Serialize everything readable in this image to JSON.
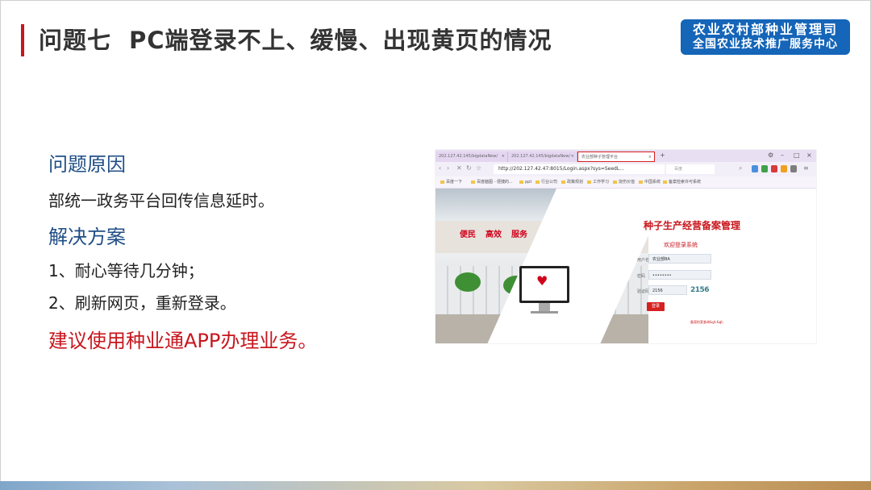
{
  "slide": {
    "title_num": "问题七",
    "title_text": "PC端登录不上、缓慢、出现黄页的情况",
    "org_line1": "农业农村部种业管理司",
    "org_line2": "全国农业技术推广服务中心"
  },
  "content": {
    "cause_heading": "问题原因",
    "cause_text": "部统一政务平台回传信息延时。",
    "solution_heading": "解决方案",
    "solution_items": [
      "1、耐心等待几分钟；",
      "2、刷新网页，重新登录。"
    ],
    "recommendation": "建议使用种业通APP办理业务。"
  },
  "screenshot": {
    "tabs": [
      {
        "label": "202.127.42.145/bigdataNew/"
      },
      {
        "label": "202.127.42.145/bigdataNew/"
      },
      {
        "label": "农业部种子管理平台"
      }
    ],
    "url": "http://202.127.42.47:8015/Login.aspx?sys=SeedL...",
    "search_placeholder": "百度",
    "bookmarks": [
      "百度一下",
      "百度脑图 - 便捷的...",
      "ppt",
      "行业公司",
      "政策规划",
      "工作学习",
      "烧伤价值",
      "中国系统",
      "备案检索许可系统"
    ],
    "banners": [
      "便民",
      "高效",
      "服务"
    ],
    "login_title": "种子生产经营备案管理",
    "login_subtitle": "欢迎登录系统",
    "username_label": "用户名",
    "username_value": "农业部BA",
    "password_label": "密码",
    "password_value": "••••••••",
    "captcha_label": "验证码",
    "captcha_input": "2156",
    "captcha_image": "2156",
    "login_button": "登录",
    "register_link": "备案检索查询&gt;&gt;"
  }
}
